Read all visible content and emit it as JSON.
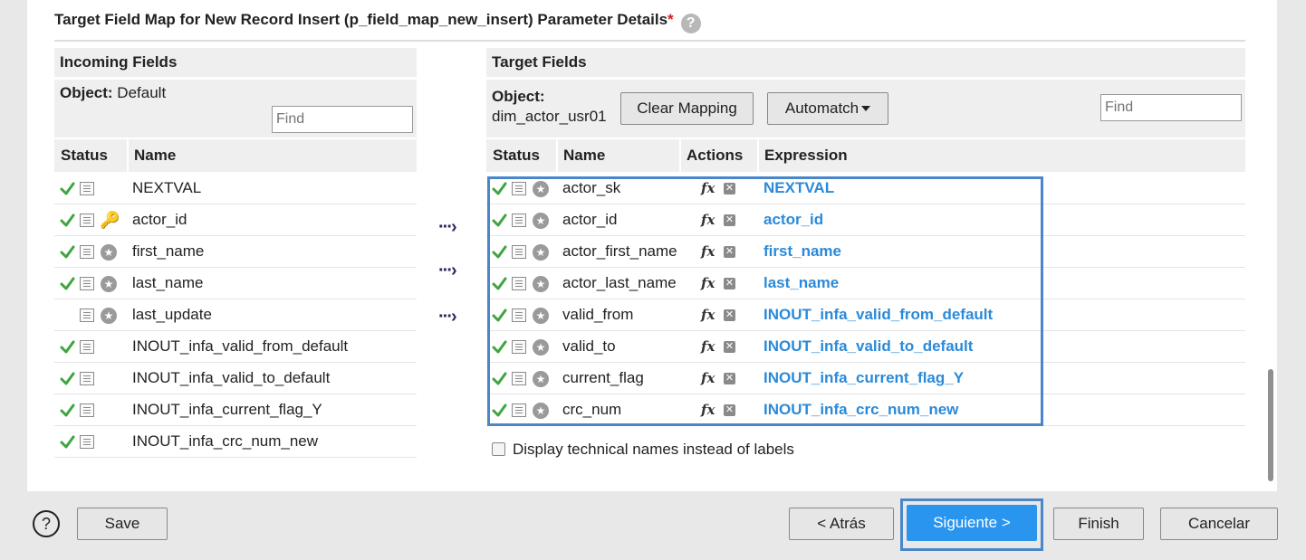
{
  "title": "Target Field Map for New Record Insert (p_field_map_new_insert) Parameter Details",
  "required_mark": "*",
  "help_badge": "?",
  "incoming": {
    "header": "Incoming Fields",
    "object_label": "Object:",
    "object_value": "Default",
    "find_placeholder": "Find",
    "col_status": "Status",
    "col_name": "Name",
    "rows": [
      {
        "check": true,
        "extra": "none",
        "name": "NEXTVAL"
      },
      {
        "check": true,
        "extra": "key",
        "name": "actor_id"
      },
      {
        "check": true,
        "extra": "star",
        "name": "first_name"
      },
      {
        "check": true,
        "extra": "star",
        "name": "last_name"
      },
      {
        "check": false,
        "extra": "star",
        "name": "last_update"
      },
      {
        "check": true,
        "extra": "none",
        "name": "INOUT_infa_valid_from_default"
      },
      {
        "check": true,
        "extra": "none",
        "name": "INOUT_infa_valid_to_default"
      },
      {
        "check": true,
        "extra": "none",
        "name": "INOUT_infa_current_flag_Y"
      },
      {
        "check": true,
        "extra": "none",
        "name": "INOUT_infa_crc_num_new"
      }
    ]
  },
  "target": {
    "header": "Target Fields",
    "object_label": "Object:",
    "object_value": "dim_actor_usr01",
    "clear_mapping_label": "Clear Mapping",
    "automatch_label": "Automatch",
    "find_placeholder": "Find",
    "col_status": "Status",
    "col_name": "Name",
    "col_actions": "Actions",
    "col_expression": "Expression",
    "rows": [
      {
        "name": "actor_sk",
        "expression": "NEXTVAL"
      },
      {
        "name": "actor_id",
        "expression": "actor_id"
      },
      {
        "name": "actor_first_name",
        "expression": "first_name"
      },
      {
        "name": "actor_last_name",
        "expression": "last_name"
      },
      {
        "name": "valid_from",
        "expression": "INOUT_infa_valid_from_default"
      },
      {
        "name": "valid_to",
        "expression": "INOUT_infa_valid_to_default"
      },
      {
        "name": "current_flag",
        "expression": "INOUT_infa_current_flag_Y"
      },
      {
        "name": "crc_num",
        "expression": "INOUT_infa_crc_num_new"
      }
    ]
  },
  "fx_label": "fx",
  "display_technical_names_label": "Display technical names instead of labels",
  "footer": {
    "help_label": "?",
    "save_label": "Save",
    "back_label": "< Atrás",
    "next_label": "Siguiente >",
    "finish_label": "Finish",
    "cancel_label": "Cancelar"
  },
  "colors": {
    "accent": "#2a95ef",
    "expression_text": "#2b8ad8",
    "check_green": "#3ea63e",
    "focus_ring": "#4a86c8",
    "key_icon": "#e0a020"
  }
}
